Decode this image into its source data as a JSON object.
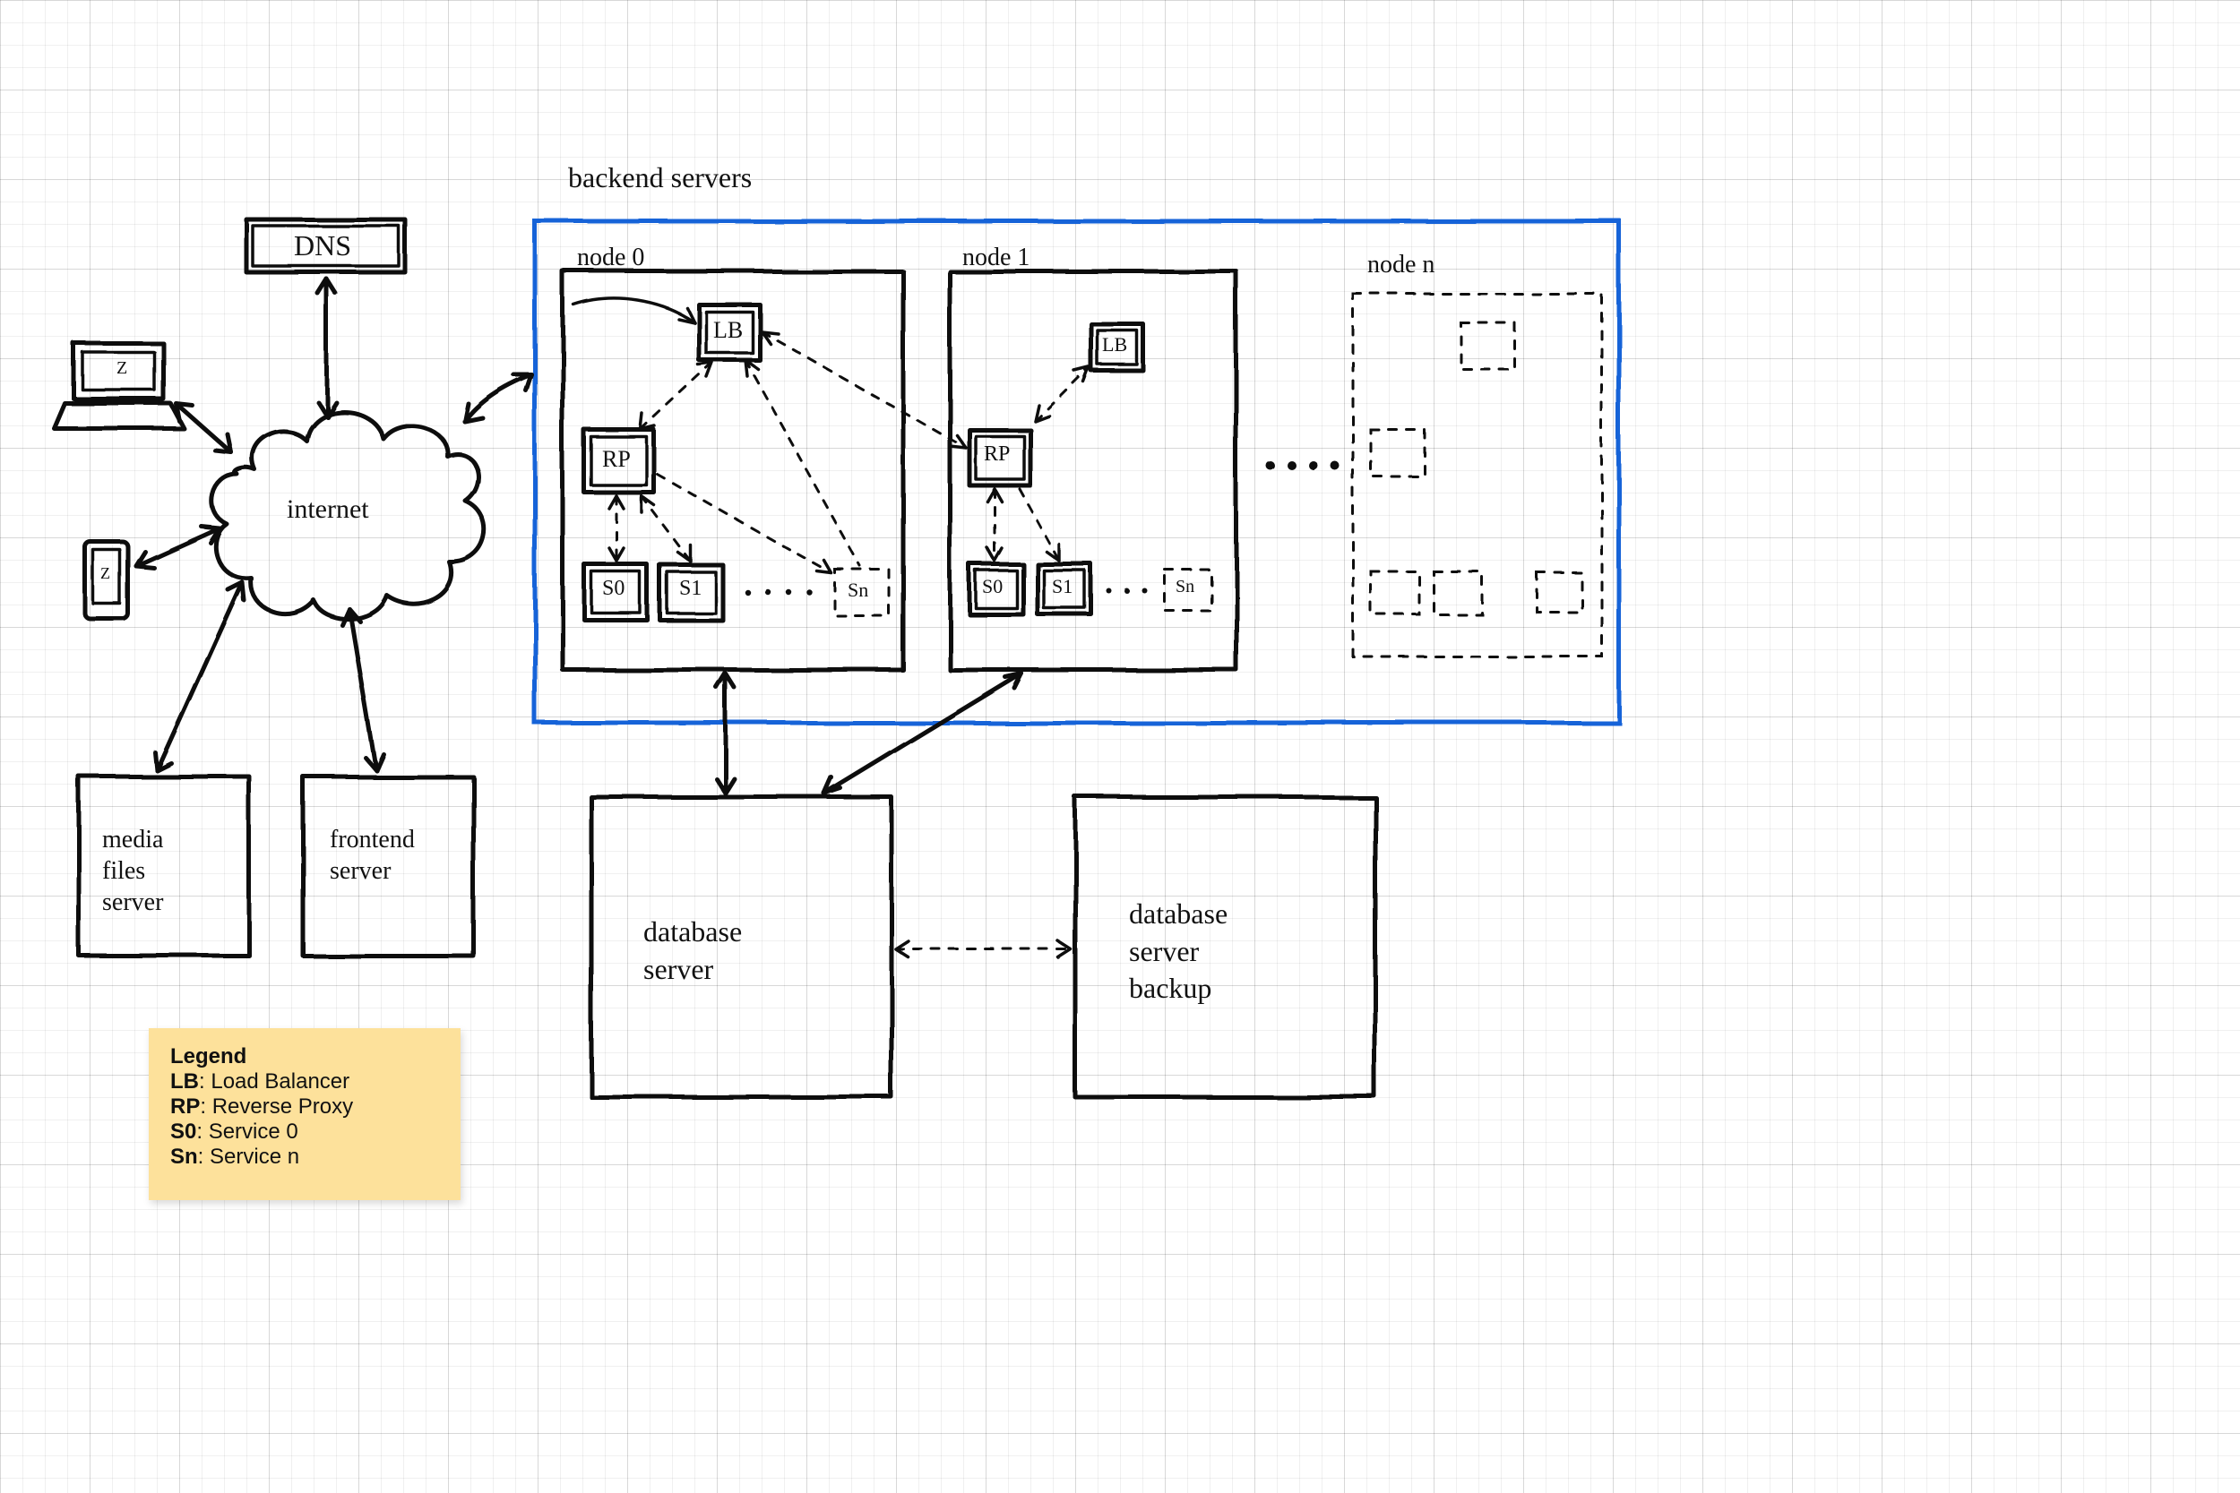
{
  "diagram": {
    "title_backend": "backend servers",
    "dns_label": "DNS",
    "internet_label": "internet",
    "node0_label": "node 0",
    "node1_label": "node 1",
    "noden_label": "node n",
    "lb_short": "LB",
    "rp_short": "RP",
    "s0_short": "S0",
    "s1_short": "S1",
    "sn_short": "Sn",
    "media_label": "media\nfiles\nserver",
    "frontend_label": "frontend\nserver",
    "db_label": "database\nserver",
    "dbbackup_label": "database\nserver\nbackup",
    "laptop_glyph": "Z",
    "phone_glyph": "Z"
  },
  "legend": {
    "heading": "Legend",
    "lines": [
      {
        "k": "LB",
        "v": "Load Balancer"
      },
      {
        "k": "RP",
        "v": "Reverse Proxy"
      },
      {
        "k": "S0",
        "v": "Service 0"
      },
      {
        "k": "Sn",
        "v": "Service n"
      }
    ]
  },
  "colors": {
    "accent_blue": "#1564d8",
    "note_yellow": "#fde19b"
  }
}
